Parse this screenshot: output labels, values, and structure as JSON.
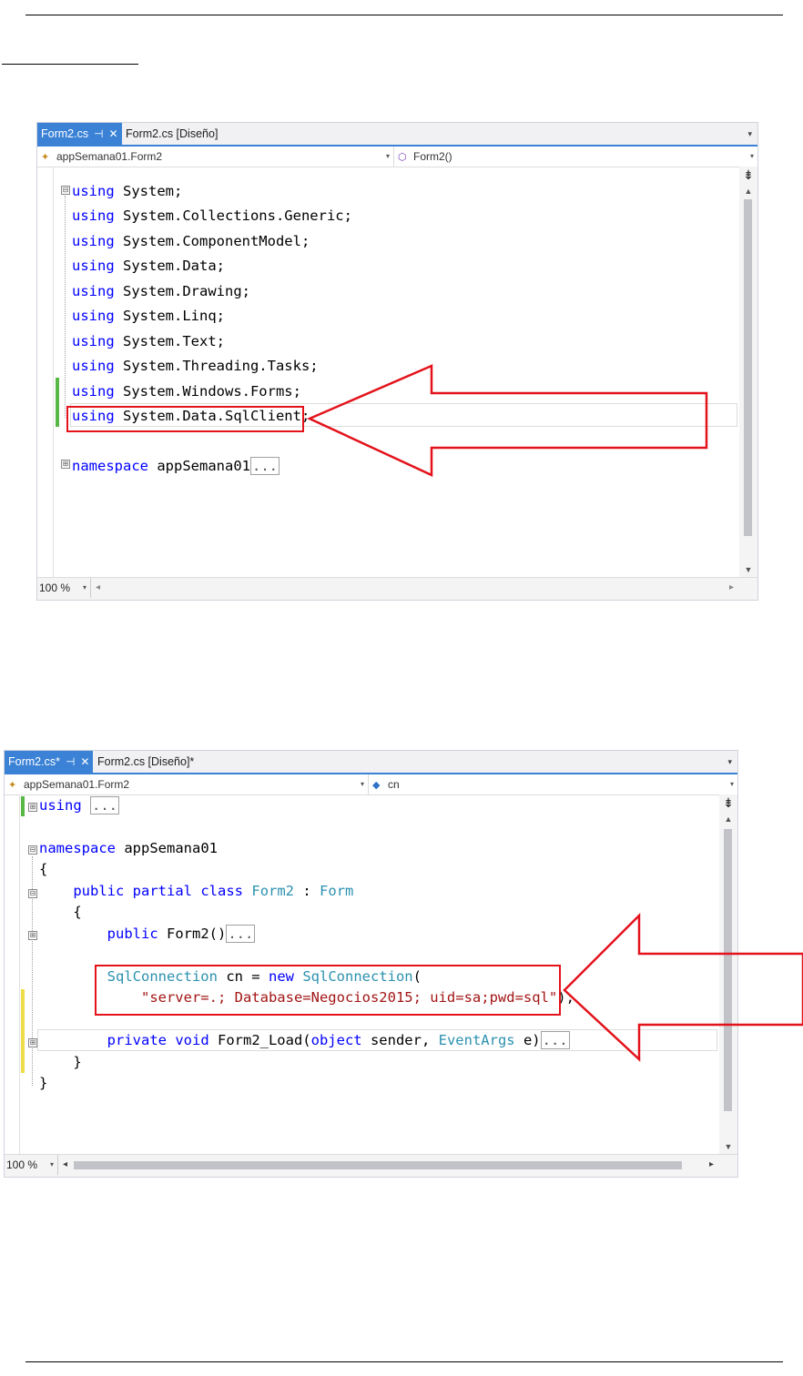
{
  "editor1": {
    "tabs": [
      {
        "label": "Form2.cs",
        "pin": "⊣",
        "close": "✕",
        "active": true
      },
      {
        "label": "Form2.cs [Diseño]",
        "active": false
      }
    ],
    "nav": {
      "left": "appSemana01.Form2",
      "right": "Form2()"
    },
    "code": {
      "l1_kw": "using",
      "l1_rest": " System;",
      "l2_kw": "using",
      "l2_rest": " System.Collections.Generic;",
      "l3_kw": "using",
      "l3_rest": " System.ComponentModel;",
      "l4_kw": "using",
      "l4_rest": " System.Data;",
      "l5_kw": "using",
      "l5_rest": " System.Drawing;",
      "l6_kw": "using",
      "l6_rest": " System.Linq;",
      "l7_kw": "using",
      "l7_rest": " System.Text;",
      "l8_kw": "using",
      "l8_rest": " System.Threading.Tasks;",
      "l9_kw": "using",
      "l9_rest": " System.Windows.Forms;",
      "l10_kw": "using",
      "l10_rest": " System.Data.SqlClient;",
      "l12_kw": "namespace",
      "l12_rest": " appSemana01",
      "l12_collapsed": "..."
    },
    "zoom": "100 %"
  },
  "editor2": {
    "tabs": [
      {
        "label": "Form2.cs*",
        "pin": "⊣",
        "close": "✕",
        "active": true
      },
      {
        "label": "Form2.cs [Diseño]*",
        "active": false
      }
    ],
    "nav": {
      "left": "appSemana01.Form2",
      "right": "cn"
    },
    "code": {
      "l1_kw": "using",
      "l1_collapsed": "...",
      "l3_kw": "namespace",
      "l3_rest": " appSemana01",
      "l4": "{",
      "l5_kw1": "public",
      "l5_kw2": "partial",
      "l5_kw3": "class",
      "l5_type": "Form2",
      "l5_sep": " : ",
      "l5_base": "Form",
      "l6": "{",
      "l7_kw": "public",
      "l7_rest": " Form2()",
      "l7_collapsed": "...",
      "l9_type1": "SqlConnection",
      "l9_mid": " cn = ",
      "l9_kw": "new",
      "l9_type2": "SqlConnection",
      "l9_end": "(",
      "l10_str": "\"server=.; Database=Negocios2015; uid=sa;pwd=sql\"",
      "l10_end": ");",
      "l12_kw1": "private",
      "l12_kw2": "void",
      "l12_name": " Form2_Load(",
      "l12_kw3": "object",
      "l12_mid": " sender, ",
      "l12_type": "EventArgs",
      "l12_end": " e)",
      "l12_collapsed": "...",
      "l13": "}",
      "l14": "}"
    },
    "zoom": "100 %"
  },
  "icons": {
    "fold_minus": "⊟",
    "fold_plus": "⊞",
    "dropdown": "▾",
    "split": "⇟"
  },
  "colors": {
    "keyword": "#0000ff",
    "type": "#2b91af",
    "string": "#a31515",
    "annotation": "#e3121b",
    "tab_active": "#3b82d6"
  }
}
